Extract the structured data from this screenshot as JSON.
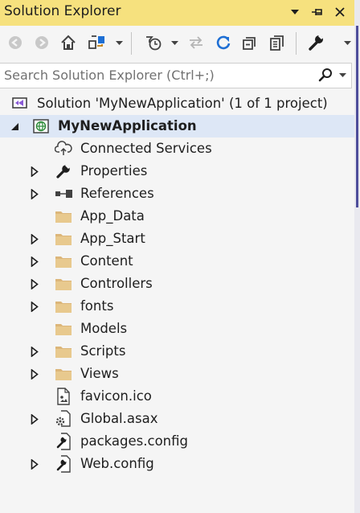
{
  "window": {
    "title": "Solution Explorer"
  },
  "title_buttons": [
    "dropdown-arrow-icon",
    "pin-icon",
    "close-icon"
  ],
  "toolbar": {
    "icons": [
      "back-icon",
      "forward-icon",
      "home-icon",
      "switch-views-icon",
      "pending-changes-filter-icon",
      "sync-with-active-document-icon",
      "refresh-icon",
      "collapse-all-icon",
      "show-all-files-icon",
      "properties-wrench-icon"
    ]
  },
  "search": {
    "placeholder": "Search Solution Explorer (Ctrl+;)"
  },
  "tree": {
    "solution_label": "Solution 'MyNewApplication' (1 of 1 project)",
    "project_label": "MyNewApplication",
    "items": [
      {
        "label": "Connected Services",
        "icon": "connected-services-icon",
        "expandable": false
      },
      {
        "label": "Properties",
        "icon": "wrench-icon",
        "expandable": true
      },
      {
        "label": "References",
        "icon": "references-icon",
        "expandable": true
      },
      {
        "label": "App_Data",
        "icon": "folder-icon",
        "expandable": false
      },
      {
        "label": "App_Start",
        "icon": "folder-icon",
        "expandable": true
      },
      {
        "label": "Content",
        "icon": "folder-icon",
        "expandable": true
      },
      {
        "label": "Controllers",
        "icon": "folder-icon",
        "expandable": true
      },
      {
        "label": "fonts",
        "icon": "folder-icon",
        "expandable": true
      },
      {
        "label": "Models",
        "icon": "folder-icon",
        "expandable": false
      },
      {
        "label": "Scripts",
        "icon": "folder-icon",
        "expandable": true
      },
      {
        "label": "Views",
        "icon": "folder-icon",
        "expandable": true
      },
      {
        "label": "favicon.ico",
        "icon": "image-file-icon",
        "expandable": false
      },
      {
        "label": "Global.asax",
        "icon": "global-asax-icon",
        "expandable": true
      },
      {
        "label": "packages.config",
        "icon": "config-file-icon",
        "expandable": false
      },
      {
        "label": "Web.config",
        "icon": "config-file-icon",
        "expandable": true
      }
    ]
  },
  "colors": {
    "title_bar": "#f6e17e",
    "selection": "#dde7f6",
    "accent": "#1e6fd4",
    "folder": "#dcb67a"
  }
}
